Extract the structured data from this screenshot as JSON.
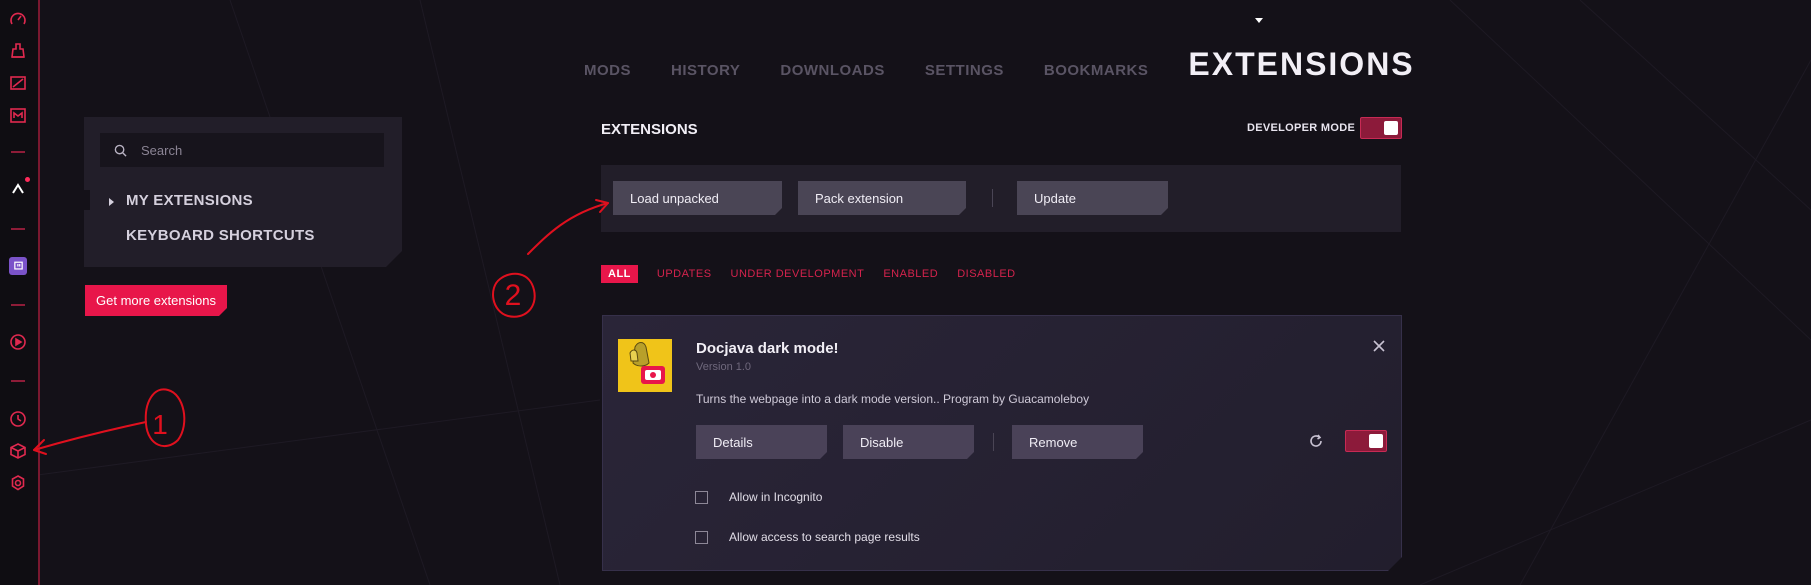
{
  "top_nav": {
    "items": [
      "MODS",
      "HISTORY",
      "DOWNLOADS",
      "SETTINGS",
      "BOOKMARKS"
    ],
    "active": "EXTENSIONS"
  },
  "sidebar": {
    "search_placeholder": "Search",
    "links": [
      "MY EXTENSIONS",
      "KEYBOARD SHORTCUTS"
    ],
    "get_more_label": "Get more extensions"
  },
  "main": {
    "title": "EXTENSIONS",
    "developer_mode_label": "DEVELOPER MODE",
    "developer_mode_on": true,
    "toolbar": {
      "load_unpacked": "Load unpacked",
      "pack_extension": "Pack extension",
      "update": "Update"
    },
    "filters": [
      "ALL",
      "UPDATES",
      "UNDER DEVELOPMENT",
      "ENABLED",
      "DISABLED"
    ],
    "active_filter": "ALL"
  },
  "extension": {
    "name": "Docjava dark mode!",
    "version": "Version 1.0",
    "description": "Turns the webpage into a dark mode version.. Program by Guacamoleboy",
    "details_label": "Details",
    "disable_label": "Disable",
    "remove_label": "Remove",
    "enabled": true,
    "allow_incognito_label": "Allow in Incognito",
    "allow_search_label": "Allow access to search page results"
  },
  "annotations": {
    "marker_1": "1",
    "marker_2": "2"
  },
  "colors": {
    "accent": "#e8164a",
    "toggle_bg": "#8c1a3a",
    "background": "#141118",
    "panel": "#221e29",
    "annotation": "#e0101e"
  }
}
